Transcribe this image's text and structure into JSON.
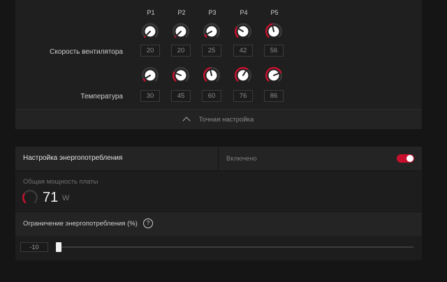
{
  "fan_curve": {
    "points": [
      "P1",
      "P2",
      "P3",
      "P4",
      "P5"
    ],
    "rows": [
      {
        "label": "Скорость вентилятора",
        "values": [
          "20",
          "20",
          "25",
          "42",
          "56"
        ],
        "knob_levels": [
          0,
          0,
          0.06,
          0.28,
          0.45
        ]
      },
      {
        "label": "Температура",
        "values": [
          "30",
          "45",
          "60",
          "76",
          "86"
        ],
        "knob_levels": [
          0.05,
          0.25,
          0.45,
          0.62,
          0.75
        ]
      }
    ],
    "fine_tune_label": "Точная настройка"
  },
  "power": {
    "title": "Настройка энергопотребления",
    "status": "Включено",
    "toggle_on": true,
    "board_label": "Общая мощность платы",
    "board_value": "71",
    "board_unit": "W",
    "board_level": 0.28,
    "limit_title": "Ограничение энергопотребления (%)",
    "help_glyph": "?",
    "limit_value": "-10",
    "limit_level": 0
  },
  "colors": {
    "accent": "#c8102e",
    "knob_face": "#ffffff",
    "knob_ring": "#3a3a3a"
  }
}
